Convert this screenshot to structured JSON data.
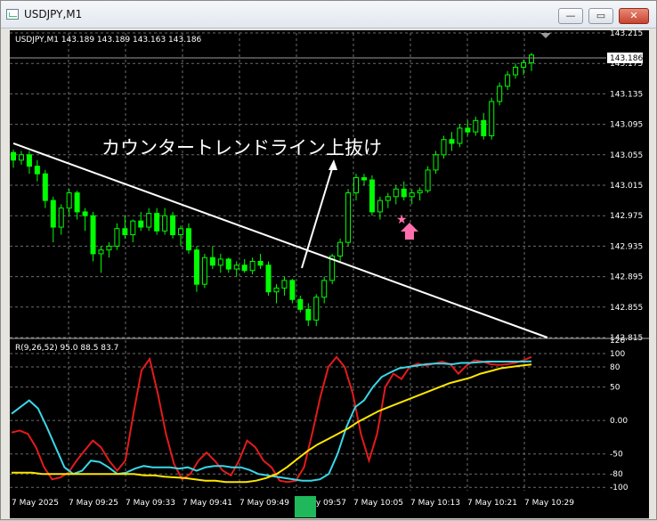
{
  "window": {
    "title": "USDJPY,M1",
    "buttons": {
      "minimize": "—",
      "maximize": "▭",
      "close": "✕"
    }
  },
  "chart": {
    "header": "USDJPY,M1  143.189 143.189 143.163 143.186",
    "current_price": "143.186",
    "annotation": "カウンタートレンドライン上抜け",
    "marker_star": "★",
    "price_ticks": [
      "143.215",
      "143.175",
      "143.135",
      "143.095",
      "143.055",
      "143.015",
      "142.975",
      "142.935",
      "142.895",
      "142.855",
      "142.815"
    ],
    "colors": {
      "bull": "#00ff00",
      "bear": "#00ff00",
      "background": "#000000",
      "grid": "#6b6b6b",
      "trendline": "#ffffff",
      "marker": "#ff6fae"
    }
  },
  "indicator": {
    "header": "R(9,26,52) 95.0 88.5 83.7",
    "ticks": [
      "120",
      "100",
      "80",
      "50",
      "0.00",
      "-50",
      "-80",
      "-100"
    ],
    "series_colors": {
      "fast": "#e31b1b",
      "mid": "#3ad7e8",
      "slow": "#ffe600"
    }
  },
  "time_labels": [
    "7 May 2025",
    "7 May 09:25",
    "7 May 09:33",
    "7 May 09:41",
    "7 May 09:49",
    "7 May 09:57",
    "7 May 10:05",
    "7 May 10:13",
    "7 May 10:21",
    "7 May 10:29"
  ],
  "chart_data": [
    {
      "type": "candlestick",
      "price_ylim": [
        142.815,
        143.215
      ],
      "ohlc": [
        [
          143.058,
          143.062,
          143.038,
          143.048
        ],
        [
          143.048,
          143.06,
          143.042,
          143.055
        ],
        [
          143.055,
          143.06,
          143.03,
          143.04
        ],
        [
          143.04,
          143.048,
          143.02,
          143.03
        ],
        [
          143.03,
          143.035,
          142.985,
          142.995
        ],
        [
          142.995,
          143.0,
          142.94,
          142.96
        ],
        [
          142.96,
          142.99,
          142.95,
          142.985
        ],
        [
          142.985,
          143.01,
          142.975,
          143.005
        ],
        [
          143.005,
          143.008,
          142.97,
          142.98
        ],
        [
          142.98,
          142.985,
          142.955,
          142.975
        ],
        [
          142.975,
          142.98,
          142.915,
          142.925
        ],
        [
          142.925,
          142.935,
          142.9,
          142.93
        ],
        [
          142.93,
          142.94,
          142.92,
          142.935
        ],
        [
          142.935,
          142.965,
          142.93,
          142.958
        ],
        [
          142.958,
          142.975,
          142.945,
          142.95
        ],
        [
          142.95,
          142.97,
          142.94,
          142.968
        ],
        [
          142.968,
          142.98,
          142.955,
          142.96
        ],
        [
          142.96,
          142.985,
          142.955,
          142.978
        ],
        [
          142.978,
          142.985,
          142.95,
          142.955
        ],
        [
          142.955,
          142.985,
          142.95,
          142.975
        ],
        [
          142.975,
          142.98,
          142.945,
          142.95
        ],
        [
          142.95,
          142.962,
          142.935,
          142.958
        ],
        [
          142.958,
          142.965,
          142.925,
          142.93
        ],
        [
          142.93,
          142.935,
          142.875,
          142.885
        ],
        [
          142.885,
          142.925,
          142.88,
          142.92
        ],
        [
          142.92,
          142.935,
          142.905,
          142.91
        ],
        [
          142.91,
          142.925,
          142.9,
          142.918
        ],
        [
          142.918,
          142.92,
          142.9,
          142.905
        ],
        [
          142.905,
          142.915,
          142.895,
          142.91
        ],
        [
          142.91,
          142.918,
          142.9,
          142.903
        ],
        [
          142.903,
          142.92,
          142.898,
          142.915
        ],
        [
          142.915,
          142.925,
          142.905,
          142.91
        ],
        [
          142.91,
          142.915,
          142.87,
          142.875
        ],
        [
          142.875,
          142.885,
          142.86,
          142.88
        ],
        [
          142.88,
          142.895,
          142.87,
          142.89
        ],
        [
          142.89,
          142.892,
          142.86,
          142.865
        ],
        [
          142.865,
          142.87,
          142.848,
          142.852
        ],
        [
          142.852,
          142.86,
          142.83,
          142.838
        ],
        [
          142.838,
          142.872,
          142.83,
          142.868
        ],
        [
          142.868,
          142.895,
          142.86,
          142.89
        ],
        [
          142.89,
          142.925,
          142.885,
          142.922
        ],
        [
          142.922,
          142.945,
          142.915,
          142.94
        ],
        [
          142.94,
          143.01,
          142.935,
          143.005
        ],
        [
          143.005,
          143.03,
          142.995,
          143.025
        ],
        [
          143.025,
          143.03,
          143.015,
          143.022
        ],
        [
          143.022,
          143.028,
          142.975,
          142.98
        ],
        [
          142.98,
          143.0,
          142.97,
          142.995
        ],
        [
          142.995,
          143.005,
          142.985,
          143.0
        ],
        [
          143.0,
          143.015,
          142.99,
          143.01
        ],
        [
          143.01,
          143.02,
          142.995,
          143.0
        ],
        [
          143.0,
          143.01,
          142.99,
          143.005
        ],
        [
          143.005,
          143.012,
          142.995,
          143.008
        ],
        [
          143.008,
          143.04,
          143.005,
          143.035
        ],
        [
          143.035,
          143.06,
          143.03,
          143.055
        ],
        [
          143.055,
          143.08,
          143.05,
          143.075
        ],
        [
          143.075,
          143.085,
          143.06,
          143.07
        ],
        [
          143.07,
          143.095,
          143.065,
          143.09
        ],
        [
          143.09,
          143.1,
          143.08,
          143.085
        ],
        [
          143.085,
          143.105,
          143.08,
          143.1
        ],
        [
          143.1,
          143.11,
          143.075,
          143.08
        ],
        [
          143.08,
          143.13,
          143.075,
          143.125
        ],
        [
          143.125,
          143.15,
          143.12,
          143.145
        ],
        [
          143.145,
          143.165,
          143.14,
          143.16
        ],
        [
          143.16,
          143.175,
          143.155,
          143.17
        ],
        [
          143.17,
          143.18,
          143.16,
          143.176
        ],
        [
          143.176,
          143.189,
          143.165,
          143.186
        ]
      ],
      "trendline": {
        "from": [
          0,
          143.07
        ],
        "to": [
          67,
          142.815
        ]
      }
    },
    {
      "type": "line",
      "title": "R(9,26,52) 95.0 88.5 83.7",
      "ylim": [
        -105,
        120
      ],
      "series": [
        {
          "name": "95.0",
          "values": [
            -18,
            -15,
            -20,
            -40,
            -70,
            -88,
            -85,
            -78,
            -60,
            -45,
            -30,
            -40,
            -60,
            -75,
            -60,
            10,
            75,
            92,
            40,
            -20,
            -65,
            -88,
            -80,
            -60,
            -48,
            -60,
            -75,
            -82,
            -60,
            -30,
            -40,
            -60,
            -70,
            -90,
            -92,
            -90,
            -70,
            -20,
            35,
            80,
            95,
            80,
            40,
            -20,
            -60,
            -20,
            50,
            70,
            62,
            80,
            85,
            82,
            85,
            88,
            84,
            70,
            82,
            90,
            88,
            84,
            83,
            84,
            86,
            90,
            95
          ]
        },
        {
          "name": "88.5",
          "values": [
            10,
            20,
            30,
            18,
            -10,
            -40,
            -70,
            -80,
            -75,
            -60,
            -62,
            -70,
            -80,
            -78,
            -72,
            -68,
            -70,
            -70,
            -70,
            -72,
            -70,
            -75,
            -70,
            -68,
            -68,
            -70,
            -70,
            -74,
            -80,
            -82,
            -84,
            -86,
            -88,
            -90,
            -90,
            -88,
            -80,
            -50,
            -10,
            20,
            30,
            50,
            65,
            72,
            78,
            80,
            82,
            84,
            85,
            85,
            84,
            86,
            86,
            87,
            88,
            88,
            88,
            88,
            88,
            88.5
          ]
        },
        {
          "name": "83.7",
          "values": [
            -78,
            -78,
            -78,
            -80,
            -80,
            -80,
            -80,
            -80,
            -80,
            -80,
            -80,
            -80,
            -80,
            -82,
            -82,
            -84,
            -85,
            -86,
            -88,
            -90,
            -90,
            -92,
            -92,
            -92,
            -90,
            -86,
            -80,
            -70,
            -58,
            -46,
            -36,
            -28,
            -20,
            -12,
            -2,
            6,
            14,
            20,
            26,
            32,
            38,
            44,
            50,
            56,
            60,
            64,
            70,
            74,
            78,
            80,
            82,
            83.7
          ]
        }
      ]
    }
  ]
}
